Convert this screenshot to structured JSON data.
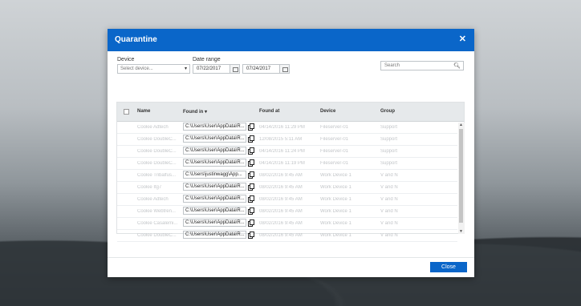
{
  "dialog": {
    "title": "Quarantine",
    "close_glyph": "✕",
    "device_label": "Device",
    "device_placeholder": "Select device...",
    "date_range_label": "Date range",
    "date_from": "07/22/2017",
    "date_to": "07/24/2017",
    "search_placeholder": "Search",
    "close_button": "Close"
  },
  "table": {
    "headers": {
      "name": "Name",
      "found_in": "Found in ▾",
      "found_at": "Found at",
      "device": "Device",
      "group": "Group"
    },
    "rows": [
      {
        "name": "Cookie Adtech",
        "path": "C:\\Users\\User\\AppData\\R...",
        "found_at": "04/14/2016 11:29 PM",
        "device": "Fileserver-01",
        "group": "Support"
      },
      {
        "name": "Cookie DoubleC...",
        "path": "C:\\Users\\User\\AppData\\R...",
        "found_at": "12/08/2015 5:11 AM",
        "device": "Fileserver-01",
        "group": "Support"
      },
      {
        "name": "Cookie DoubleC...",
        "path": "C:\\Users\\User\\AppData\\R...",
        "found_at": "04/14/2016 11:24 PM",
        "device": "Fileserver-01",
        "group": "Support"
      },
      {
        "name": "Cookie DoubleC...",
        "path": "C:\\Users\\User\\AppData\\R...",
        "found_at": "04/14/2016 11:19 PM",
        "device": "Fileserver-01",
        "group": "Support"
      },
      {
        "name": "Cookie Tribalfus...",
        "path": "C:\\Users\\justinwagg\\App...",
        "found_at": "08/02/2016 9:45 AM",
        "device": "Work Device 1",
        "group": "V and N"
      },
      {
        "name": "Cookie Itg7",
        "path": "C:\\Users\\User\\AppData\\R...",
        "found_at": "08/02/2016 9:45 AM",
        "device": "Work Device 1",
        "group": "V and N"
      },
      {
        "name": "Cookie Adtech",
        "path": "C:\\Users\\User\\AppData\\R...",
        "found_at": "08/02/2016 9:45 AM",
        "device": "Work Device 1",
        "group": "V and N"
      },
      {
        "name": "Cookie Webtren...",
        "path": "C:\\Users\\User\\AppData\\R...",
        "found_at": "08/02/2016 9:45 AM",
        "device": "Work Device 1",
        "group": "V and N"
      },
      {
        "name": "Cookie Casalemi...",
        "path": "C:\\Users\\User\\AppData\\R...",
        "found_at": "08/02/2016 9:45 AM",
        "device": "Work Device 1",
        "group": "V and N"
      },
      {
        "name": "Cookie DoubleC...",
        "path": "C:\\Users\\User\\AppData\\R...",
        "found_at": "08/02/2016 9:45 AM",
        "device": "Work Device 1",
        "group": "V and N"
      }
    ]
  },
  "colors": {
    "accent": "#0a66c9",
    "muted_text": "#c3c6c9",
    "header_bg": "#e6e9eb"
  }
}
